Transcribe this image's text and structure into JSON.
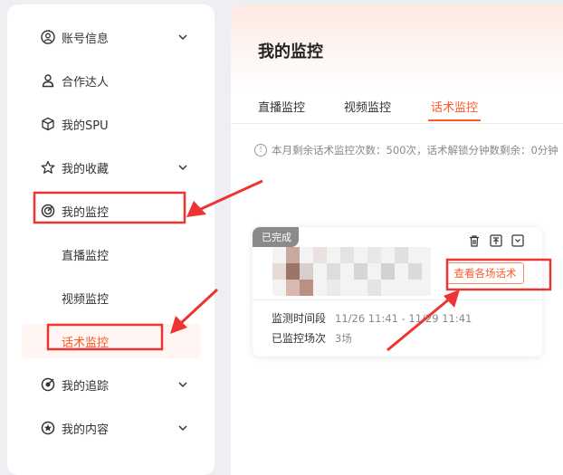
{
  "sidebar": {
    "items": [
      {
        "label": "账号信息",
        "icon": "user-circle-icon",
        "has_chevron": true
      },
      {
        "label": "合作达人",
        "icon": "person-icon",
        "has_chevron": false
      },
      {
        "label": "我的SPU",
        "icon": "box-icon",
        "has_chevron": false
      },
      {
        "label": "我的收藏",
        "icon": "star-icon",
        "has_chevron": true
      },
      {
        "label": "我的监控",
        "icon": "radar-icon",
        "has_chevron": false
      },
      {
        "label": "我的追踪",
        "icon": "target-icon",
        "has_chevron": true
      },
      {
        "label": "我的内容",
        "icon": "star-badge-icon",
        "has_chevron": true
      }
    ],
    "sub_items": [
      {
        "label": "直播监控"
      },
      {
        "label": "视频监控"
      },
      {
        "label": "话术监控"
      }
    ]
  },
  "main": {
    "title": "我的监控",
    "tabs": [
      {
        "label": "直播监控"
      },
      {
        "label": "视频监控"
      },
      {
        "label": "话术监控"
      }
    ],
    "notice": "本月剩余话术监控次数：500次，话术解锁分钟数剩余：0分钟"
  },
  "card": {
    "status": "已完成",
    "view_button": "查看各场话术",
    "period_label": "监测时间段",
    "period_value": "11/26 11:41  -  11/29 11:41",
    "sessions_label": "已监控场次",
    "sessions_value": "3场"
  },
  "colors": {
    "accent": "#ff5a2b",
    "annotation": "#ee3333",
    "badge": "#8a8a8a"
  }
}
